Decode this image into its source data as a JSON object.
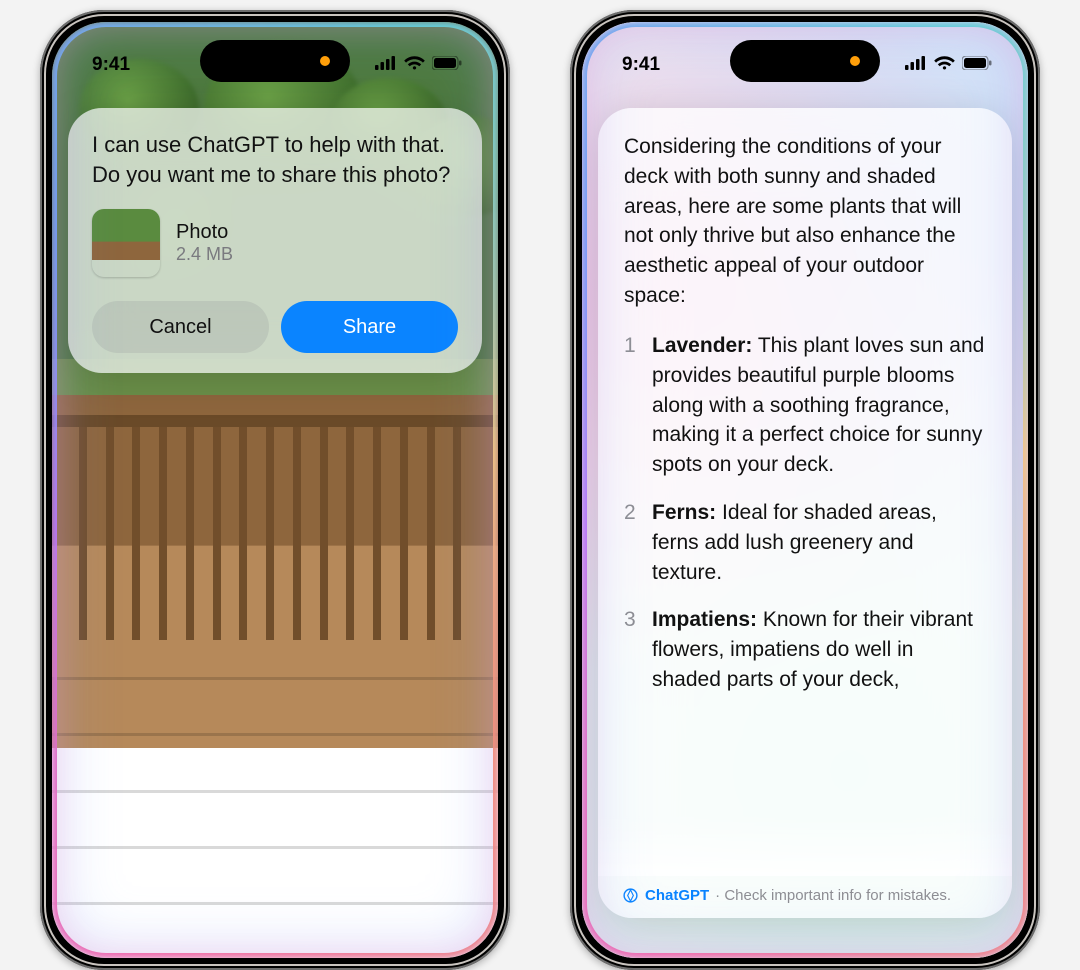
{
  "status": {
    "time": "9:41"
  },
  "left": {
    "prompt": "I can use ChatGPT to help with that. Do you want me to share this photo?",
    "attachment": {
      "title": "Photo",
      "size": "2.4 MB"
    },
    "buttons": {
      "cancel": "Cancel",
      "share": "Share"
    }
  },
  "right": {
    "intro": "Considering the conditions of your deck with both sunny and shaded areas, here are some plants that will not only thrive but also enhance the aesthetic appeal of your outdoor space:",
    "plants": [
      {
        "num": "1",
        "name": "Lavender:",
        "desc": " This plant loves sun and provides beautiful purple blooms along with a soothing fragrance, making it a perfect choice for sunny spots on your deck."
      },
      {
        "num": "2",
        "name": "Ferns:",
        "desc": " Ideal for shaded areas, ferns add lush greenery and texture."
      },
      {
        "num": "3",
        "name": "Impatiens:",
        "desc": " Known for their vibrant flowers, impatiens do well in shaded parts of your deck,"
      }
    ],
    "attribution": {
      "brand": "ChatGPT",
      "note": " · Check important info for mistakes."
    }
  }
}
